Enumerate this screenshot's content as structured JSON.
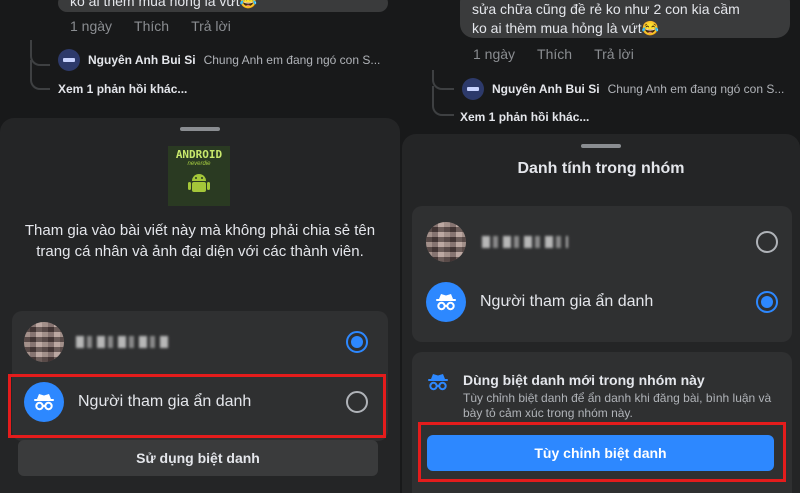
{
  "left": {
    "comment": {
      "text": "ko ai thèm mua hỏng là vứt😂"
    },
    "actions": [
      "1 ngày",
      "Thích",
      "Trả lời"
    ],
    "reply": {
      "name": "Nguyên Anh Bui Si",
      "text": "Chung Anh em đang ngó con S..."
    },
    "more_replies": "Xem 1 phản hồi khác...",
    "sheet": {
      "logo_text": "ANDROID",
      "logo_sub": "neverdie",
      "description": "Tham gia vào bài viết này mà không phải chia sẻ tên trang cá nhân và ảnh đại diện với các thành viên.",
      "option_profile_selected": true,
      "option_anonymous_label": "Người tham gia ẩn danh",
      "option_anonymous_selected": false,
      "use_nickname_button": "Sử dụng biệt danh"
    }
  },
  "right": {
    "comment": {
      "line1": "sửa chữa cũng đề rẻ ko như 2 con kia cầm",
      "line2": "ko ai thèm mua hỏng là vứt😂"
    },
    "actions": [
      "1 ngày",
      "Thích",
      "Trả lời"
    ],
    "reply": {
      "name": "Nguyên Anh Bui Si",
      "text": "Chung Anh em đang ngó con S..."
    },
    "more_replies": "Xem 1 phản hồi khác...",
    "sheet": {
      "title": "Danh tính trong nhóm",
      "option_profile_selected": false,
      "option_anonymous_label": "Người tham gia ẩn danh",
      "option_anonymous_selected": true,
      "nickname_title": "Dùng biệt danh mới trong nhóm này",
      "nickname_desc": "Tùy chỉnh biệt danh để ẩn danh khi đăng bài, bình luận và bày tỏ cảm xúc trong nhóm này.",
      "customize_button": "Tùy chỉnh biệt danh"
    }
  },
  "colors": {
    "accent": "#2d88ff",
    "highlight": "#e41c1c",
    "sheet": "#242526"
  }
}
